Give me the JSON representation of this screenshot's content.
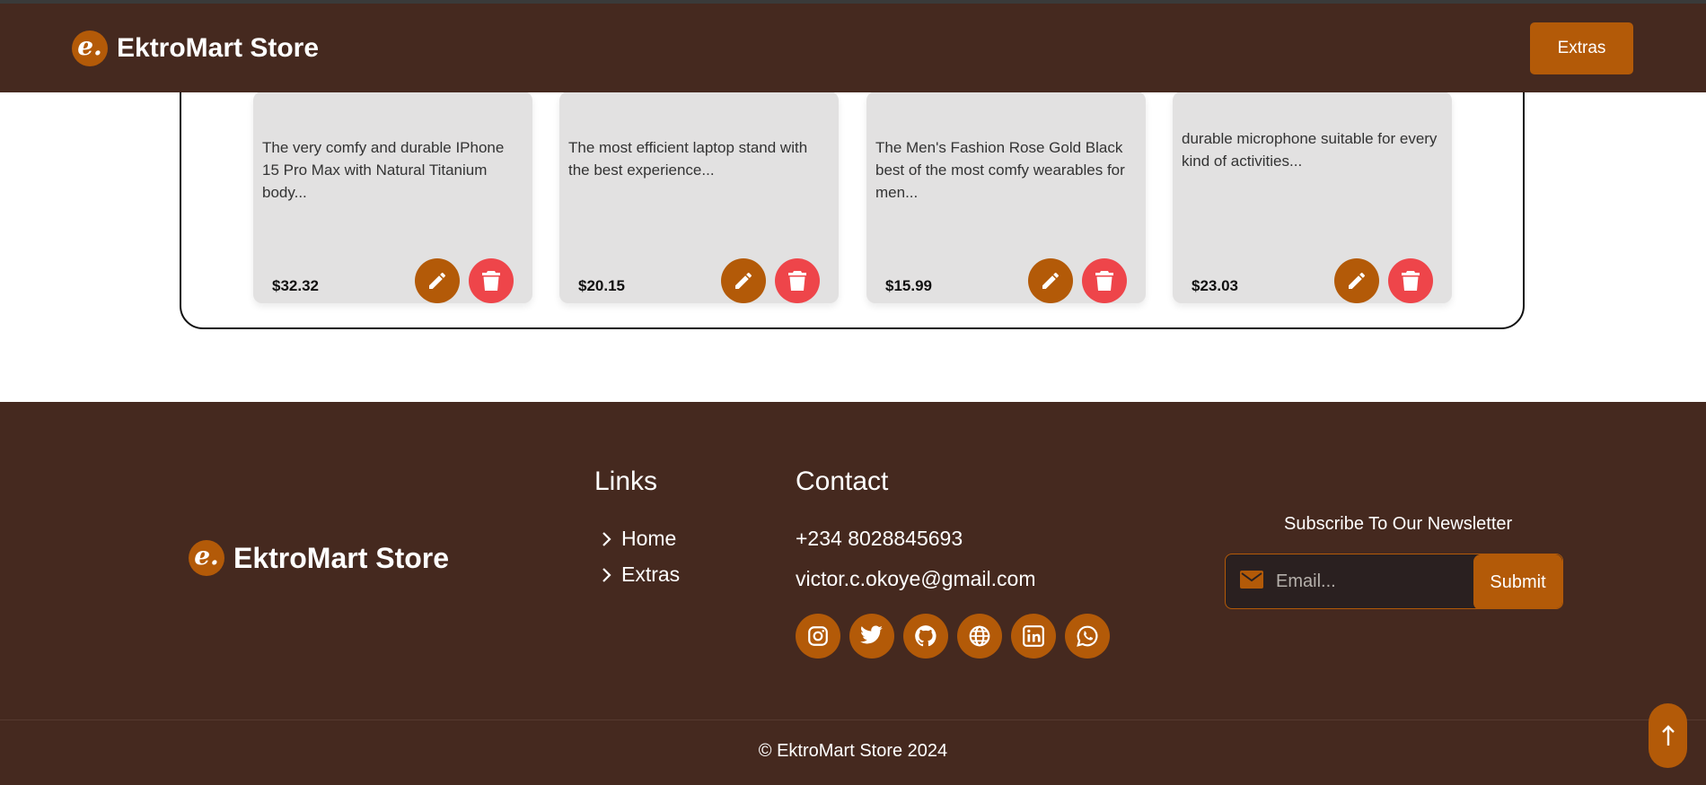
{
  "header": {
    "logo_mark": "e.",
    "brand": "EktroMart Store",
    "extras_label": "Extras"
  },
  "products": [
    {
      "description": "The very comfy and durable IPhone 15 Pro Max with Natural Titanium body...",
      "price": "$32.32"
    },
    {
      "description": "The most efficient laptop stand with the best experience...",
      "price": "$20.15"
    },
    {
      "description": "The Men's Fashion Rose Gold Black best of the most comfy wearables for men...",
      "price": "$15.99"
    },
    {
      "description": "durable microphone suitable for every kind of activities...",
      "price": "$23.03"
    }
  ],
  "footer": {
    "logo_mark": "e.",
    "brand": "EktroMart Store",
    "links_title": "Links",
    "links": [
      "Home",
      "Extras"
    ],
    "contact_title": "Contact",
    "phone": "+234 8028845693",
    "email": "victor.c.okoye@gmail.com",
    "socials": [
      "instagram-icon",
      "twitter-icon",
      "github-icon",
      "globe-icon",
      "linkedin-icon",
      "whatsapp-icon"
    ],
    "newsletter_title": "Subscribe To Our Newsletter",
    "email_placeholder": "Email...",
    "submit_label": "Submit",
    "copyright": "© EktroMart Store 2024"
  },
  "colors": {
    "brown": "#45291f",
    "accent": "#b35a08",
    "delete": "#ee454a",
    "card": "#e2e1e1"
  }
}
